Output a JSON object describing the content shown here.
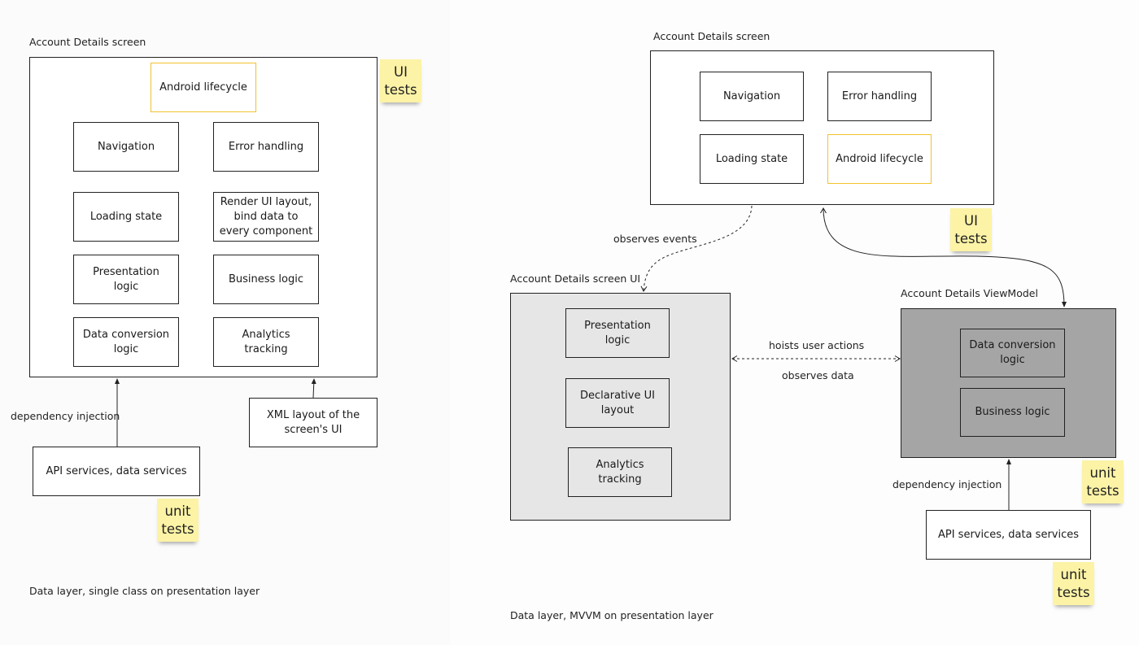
{
  "left": {
    "container_title": "Account Details screen",
    "boxes": {
      "android_lifecycle": "Android lifecycle",
      "navigation": "Navigation",
      "error_handling": "Error handling",
      "loading_state": "Loading state",
      "render_ui": "Render UI layout, bind data to every component",
      "presentation_logic": "Presentation logic",
      "business_logic": "Business logic",
      "data_conversion": "Data conversion logic",
      "analytics": "Analytics tracking",
      "xml_layout": "XML layout of the screen's UI",
      "api_services": "API services, data services"
    },
    "edge_labels": {
      "dependency_injection": "dependency injection"
    },
    "stickies": {
      "ui_tests": "UI\ntests",
      "unit_tests": "unit\ntests"
    },
    "caption": "Data layer, single class on presentation layer"
  },
  "right": {
    "screen_title": "Account Details screen",
    "screen_boxes": {
      "navigation": "Navigation",
      "error_handling": "Error handling",
      "loading_state": "Loading state",
      "android_lifecycle": "Android lifecycle"
    },
    "ui_title": "Account Details screen UI",
    "ui_boxes": {
      "presentation_logic": "Presentation logic",
      "declarative_ui": "Declarative UI layout",
      "analytics": "Analytics tracking"
    },
    "vm_title": "Account Details ViewModel",
    "vm_boxes": {
      "data_conversion": "Data conversion logic",
      "business_logic": "Business logic"
    },
    "api_services": "API services, data services",
    "edge_labels": {
      "observes_events": "observes events",
      "hoists_user_actions": "hoists user actions",
      "observes_data": "observes data",
      "dependency_injection": "dependency injection"
    },
    "stickies": {
      "ui_tests": "UI\ntests",
      "vm_unit_tests": "unit\ntests",
      "api_unit_tests": "unit\ntests"
    },
    "caption": "Data layer, MVVM on presentation layer"
  },
  "colors": {
    "highlight_border": "#f2c230",
    "sticky": "#fcf3a6",
    "ui_container_fill": "#e6e6e6",
    "viewmodel_fill": "#a5a5a5"
  }
}
